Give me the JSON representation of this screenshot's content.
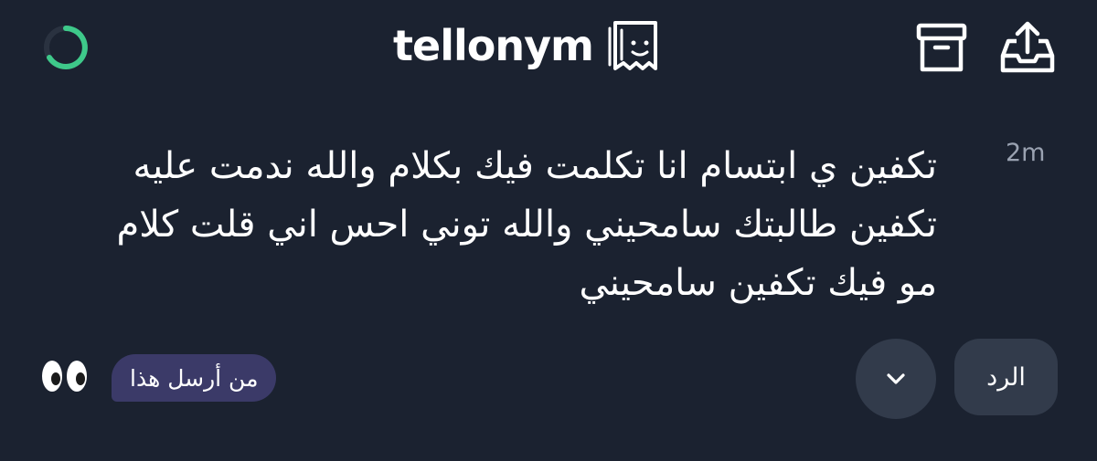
{
  "header": {
    "logo_text": "tellonym",
    "icons": {
      "loader": "loading-spinner-icon",
      "logo_mark": "ghost-paper-icon",
      "archive": "archive-box-icon",
      "share": "share-upload-icon"
    },
    "accent_color": "#3ec98a"
  },
  "message": {
    "time": "2m",
    "text": "تكفين ي ابتسام انا تكلمت فيك بكلام والله ندمت عليه\nتكفين طالبتك سامحيني والله توني احس اني قلت كلام\nمو فيك تكفين سامحيني"
  },
  "footer": {
    "emoji": "👀",
    "sender_label": "من أرسل هذا",
    "reply_label": "الرد",
    "expand_icon": "chevron-down-icon",
    "badge_color": "#3b3a68",
    "button_color": "#323b4b"
  },
  "colors": {
    "background": "#1b2230",
    "muted_text": "#9aa2b1"
  }
}
